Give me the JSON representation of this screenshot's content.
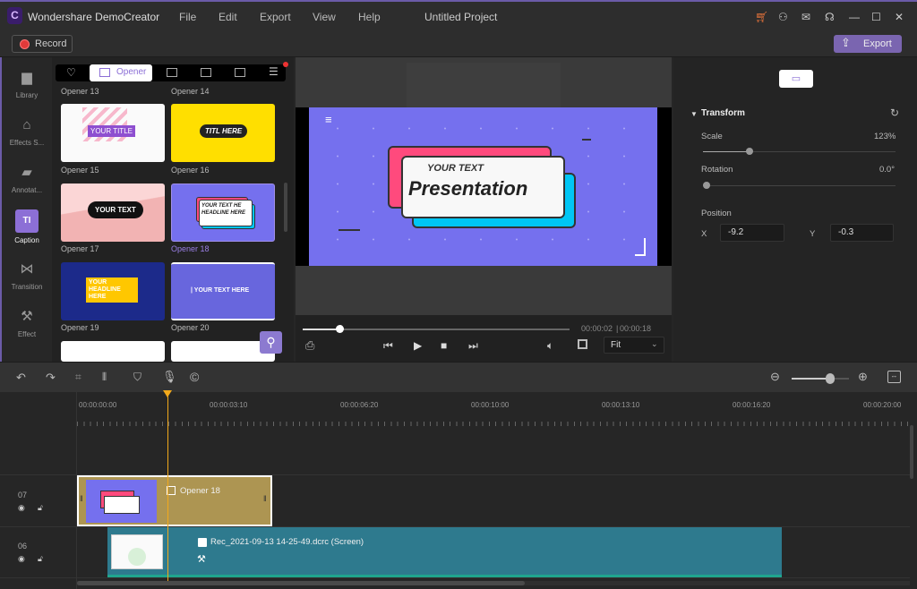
{
  "app": {
    "title": "Wondershare DemoCreator",
    "project": "Untitled Project",
    "menu": [
      "File",
      "Edit",
      "Export",
      "View",
      "Help"
    ]
  },
  "toolbar": {
    "record_label": "Record",
    "export_label": "Export"
  },
  "sidebar": {
    "items": [
      {
        "label": "Library",
        "icon": "folder-icon"
      },
      {
        "label": "Effects S...",
        "icon": "store-icon"
      },
      {
        "label": "Annotat...",
        "icon": "annotation-icon"
      },
      {
        "label": "Caption",
        "icon": "caption-icon",
        "active": true
      },
      {
        "label": "Transition",
        "icon": "transition-icon"
      },
      {
        "label": "Effect",
        "icon": "magic-wand-icon"
      }
    ]
  },
  "library": {
    "active_tab": "Opener",
    "items": [
      {
        "label": "Opener 13"
      },
      {
        "label": "Opener 14"
      },
      {
        "label": "Opener 15",
        "text": "YOUR TITLE"
      },
      {
        "label": "Opener 16",
        "text": "TITL HERE"
      },
      {
        "label": "Opener 17",
        "text": "YOUR TEXT"
      },
      {
        "label": "Opener 18",
        "text": "YOUR TEXT HE HEADLINE HERE",
        "selected": true
      },
      {
        "label": "Opener 19",
        "text": "YOUR HEADLINE HERE"
      },
      {
        "label": "Opener 20",
        "text": "| YOUR TEXT HERE"
      }
    ]
  },
  "preview": {
    "small_text": "YOUR TEXT",
    "big_text": "Presentation",
    "current_time": "00:00:02",
    "total_time": "00:00:18",
    "progress": 0.14,
    "zoom_option": "Fit"
  },
  "properties": {
    "section": "Transform",
    "scale_label": "Scale",
    "scale_value": "123%",
    "scale_level": 0.24,
    "rotation_label": "Rotation",
    "rotation_value": "0.0°",
    "rotation_level": 0,
    "position_label": "Position",
    "x_label": "X",
    "x_value": "-9.2",
    "y_label": "Y",
    "y_value": "-0.3"
  },
  "timeline": {
    "zoom_level": 0.67,
    "ruler": [
      "00:00:00:00",
      "00:00:03:10",
      "00:00:06:20",
      "00:00:10:00",
      "00:00:13:10",
      "00:00:16:20",
      "00:00:20:00"
    ],
    "tracks": [
      {
        "number": "07",
        "clip": "Opener 18"
      },
      {
        "number": "06",
        "clip": "Rec_2021-09-13 14-25-49.dcrc (Screen)"
      }
    ]
  },
  "colors": {
    "accent": "#8c6fd6",
    "export_btn": "#7a65b0",
    "opener_clip": "#ad9552",
    "screen_clip": "#2e7a8e",
    "playhead": "#f2a91b",
    "preview_bg": "#7570ee"
  }
}
